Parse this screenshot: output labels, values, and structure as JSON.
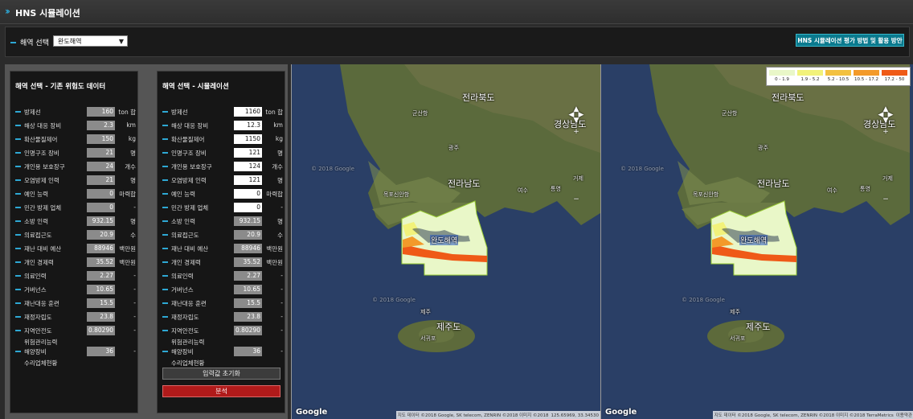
{
  "app": {
    "title": "HNS 시뮬레이션"
  },
  "selector": {
    "label": "해역 선택",
    "value": "완도해역",
    "guide_button": "HNS 시뮬레이션 평가 방법 및 활용 방안"
  },
  "left_panel": {
    "title": "해역 선택 - 기존 위험도 데이터",
    "rows": [
      {
        "label": "방제선",
        "value": "160",
        "unit": "ton 합"
      },
      {
        "label": "해상 대응 장비",
        "value": "2.3",
        "unit": "km"
      },
      {
        "label": "확산물질제어",
        "value": "150",
        "unit": "kg"
      },
      {
        "label": "인명구조 장비",
        "value": "21",
        "unit": "명"
      },
      {
        "label": "개인용 보호장구",
        "value": "24",
        "unit": "개수"
      },
      {
        "label": "오염방제 인력",
        "value": "21",
        "unit": "명"
      },
      {
        "label": "예인 능력",
        "value": "0",
        "unit": "마력합"
      },
      {
        "label": "민간 방제 업체",
        "value": "0",
        "unit": "-"
      },
      {
        "label": "소방 인력",
        "value": "932.15",
        "unit": "명"
      },
      {
        "label": "의료접근도",
        "value": "20.9",
        "unit": "수"
      },
      {
        "label": "재난 대비 예산",
        "value": "88946",
        "unit": "백만원"
      },
      {
        "label": "개인 경제력",
        "value": "35.52",
        "unit": "백만원"
      },
      {
        "label": "의료인력",
        "value": "2.27",
        "unit": "-"
      },
      {
        "label": "거버넌스",
        "value": "10.65",
        "unit": "-"
      },
      {
        "label": "재난대응 훈련",
        "value": "15.5",
        "unit": "-"
      },
      {
        "label": "재정자립도",
        "value": "23.8",
        "unit": "-"
      },
      {
        "label": "지역안전도",
        "sub": "위험관리능력",
        "value": "0.80290",
        "unit": "-"
      },
      {
        "label": "해양장비",
        "sub": "수리업체현황",
        "value": "36",
        "unit": "-"
      }
    ]
  },
  "right_panel": {
    "title": "해역 선택 - 시뮬레이션",
    "rows": [
      {
        "label": "방제선",
        "value": "1160",
        "unit": "ton 합"
      },
      {
        "label": "해상 대응 장비",
        "value": "12.3",
        "unit": "km"
      },
      {
        "label": "확산물질제어",
        "value": "1150",
        "unit": "kg"
      },
      {
        "label": "인명구조 장비",
        "value": "121",
        "unit": "명"
      },
      {
        "label": "개인용 보호장구",
        "value": "124",
        "unit": "개수"
      },
      {
        "label": "오염방제 인력",
        "value": "121",
        "unit": "명"
      },
      {
        "label": "예인 능력",
        "value": "0",
        "unit": "마력합"
      },
      {
        "label": "민간 방제 업체",
        "value": "0",
        "unit": "-"
      },
      {
        "label": "소방 인력",
        "value": "932.15",
        "unit": "명"
      },
      {
        "label": "의료접근도",
        "value": "20.9",
        "unit": "수"
      },
      {
        "label": "재난 대비 예산",
        "value": "88946",
        "unit": "백만원"
      },
      {
        "label": "개인 경제력",
        "value": "35.52",
        "unit": "백만원"
      },
      {
        "label": "의료인력",
        "value": "2.27",
        "unit": "-"
      },
      {
        "label": "거버넌스",
        "value": "10.65",
        "unit": "-"
      },
      {
        "label": "재난대응 훈련",
        "value": "15.5",
        "unit": "-"
      },
      {
        "label": "재정자립도",
        "value": "23.8",
        "unit": "-"
      },
      {
        "label": "지역안전도",
        "sub": "위험관리능력",
        "value": "0.80290",
        "unit": "-"
      },
      {
        "label": "해양장비",
        "sub": "수리업체현황",
        "value": "36",
        "unit": "-"
      }
    ],
    "reset_button": "입력값 초기화",
    "run_button": "분석"
  },
  "maps": {
    "labels": {
      "jeonbuk": "전라북도",
      "gyeongnam": "경상남도",
      "jeonnam": "전라남도",
      "wando": "완도해역",
      "jeju_island": "제주도",
      "jeju_city": "제주",
      "seogwipo": "서귀포",
      "gunsan": "군산항",
      "gwangju": "광주",
      "mokpo": "목포신안항",
      "yeosu": "여수",
      "tongyeong": "통영",
      "geoje": "거제"
    },
    "google": "Google",
    "attribution_left": "지도 데이터 ©2018 Google, SK telecom, ZENRIN ©2018 이미지 ©2018",
    "coords": "125.65969, 33.34530",
    "attribution_right": "지도 데이터 ©2018 Google, SK telecom, ZENRIN ©2018 이미지 ©2018 TerraMetrics",
    "terms": "이용약관",
    "watermark": "© 2018 Google"
  },
  "legend": {
    "items": [
      {
        "label": "0 - 1.9",
        "color": "#e9f7c8"
      },
      {
        "label": "1.9 - 5.2",
        "color": "#f2f27a"
      },
      {
        "label": "5.2 - 10.5",
        "color": "#f3c140"
      },
      {
        "label": "10.5 - 17.2",
        "color": "#f39a2a"
      },
      {
        "label": "17.2 - 50",
        "color": "#ef5a17"
      }
    ]
  }
}
